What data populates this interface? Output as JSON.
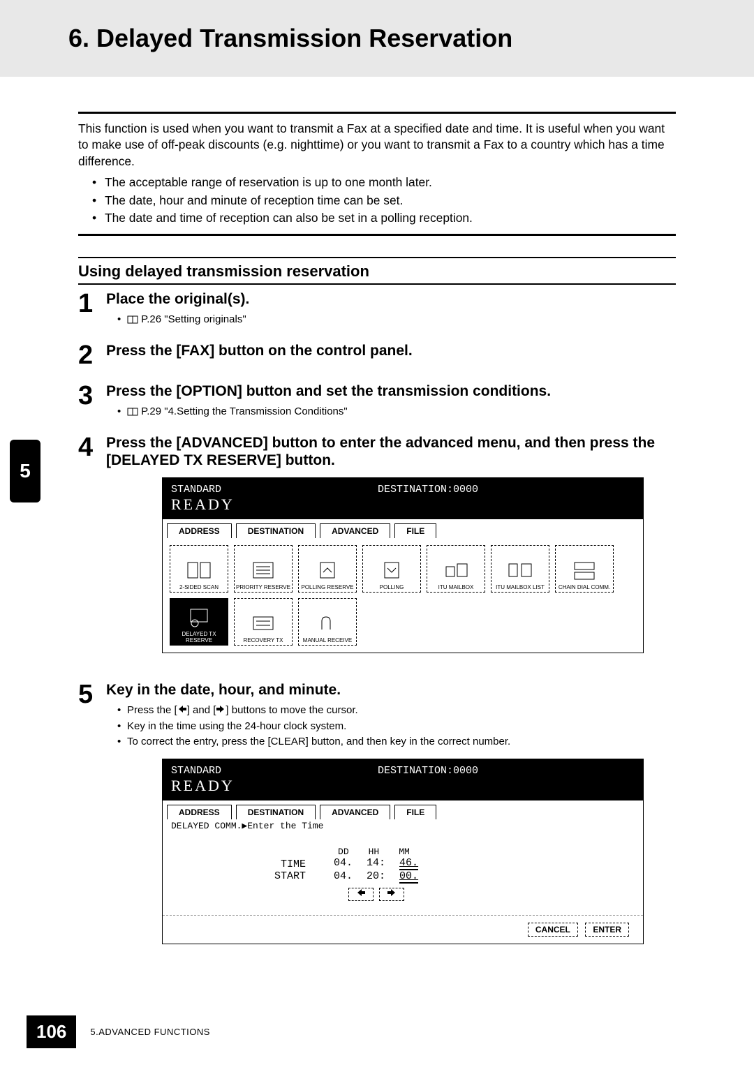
{
  "header": {
    "title": "6. Delayed Transmission Reservation"
  },
  "intro": "This function is used when you want to transmit a Fax at a specified date and time. It is useful when you want to make use of off-peak discounts (e.g. nighttime) or you want to transmit a Fax to a country which has a time difference.",
  "intro_bullets": [
    "The acceptable range of reservation is up to one month later.",
    "The date, hour and minute of reception time can be set.",
    "The date and time of reception can also be set in a polling reception."
  ],
  "section_title": "Using delayed transmission reservation",
  "side_tab": "5",
  "steps": {
    "s1": {
      "num": "1",
      "title": "Place the original(s).",
      "ref": "P.26 \"Setting originals\""
    },
    "s2": {
      "num": "2",
      "title": "Press the [FAX] button on the control panel."
    },
    "s3": {
      "num": "3",
      "title": "Press the [OPTION] button and set the transmission conditions.",
      "ref": "P.29 \"4.Setting the Transmission Conditions\""
    },
    "s4": {
      "num": "4",
      "title": "Press the [ADVANCED] button to enter the advanced menu, and then press the [DELAYED TX RESERVE] button."
    },
    "s5": {
      "num": "5",
      "title": "Key in the date, hour, and minute.",
      "notes": {
        "a_pre": "Press the [",
        "a_mid": "] and [",
        "a_post": "] buttons to move the cursor.",
        "b": "Key in the time using the 24-hour clock system.",
        "c": "To correct the entry, press the [CLEAR] button, and then key in the correct number."
      }
    }
  },
  "screen1": {
    "standard": "STANDARD",
    "dest": "DESTINATION:0000",
    "ready": "READY",
    "tabs": [
      "ADDRESS",
      "DESTINATION",
      "ADVANCED",
      "FILE"
    ],
    "options": [
      "2-SIDED SCAN",
      "PRIORITY RESERVE",
      "POLLING RESERVE",
      "POLLING",
      "ITU MAILBOX",
      "ITU MAILBOX LIST",
      "CHAIN DIAL COMM.",
      "DELAYED TX RESERVE",
      "RECOVERY TX",
      "MANUAL RECEIVE"
    ]
  },
  "screen2": {
    "standard": "STANDARD",
    "dest": "DESTINATION:0000",
    "ready": "READY",
    "tabs": [
      "ADDRESS",
      "DESTINATION",
      "ADVANCED",
      "FILE"
    ],
    "prompt": "DELAYED COMM.▶Enter the Time",
    "cols": {
      "dd": "DD",
      "hh": "HH",
      "mm": "MM"
    },
    "time_row_label": "TIME",
    "start_row_label": "START",
    "time_vals": {
      "dd": "04.",
      "hh": "14:",
      "mm": "46."
    },
    "start_vals": {
      "dd": "04.",
      "hh": "20:",
      "mm": "00."
    },
    "cancel": "CANCEL",
    "enter": "ENTER"
  },
  "footer": {
    "page": "106",
    "chapter": "5.ADVANCED FUNCTIONS"
  }
}
